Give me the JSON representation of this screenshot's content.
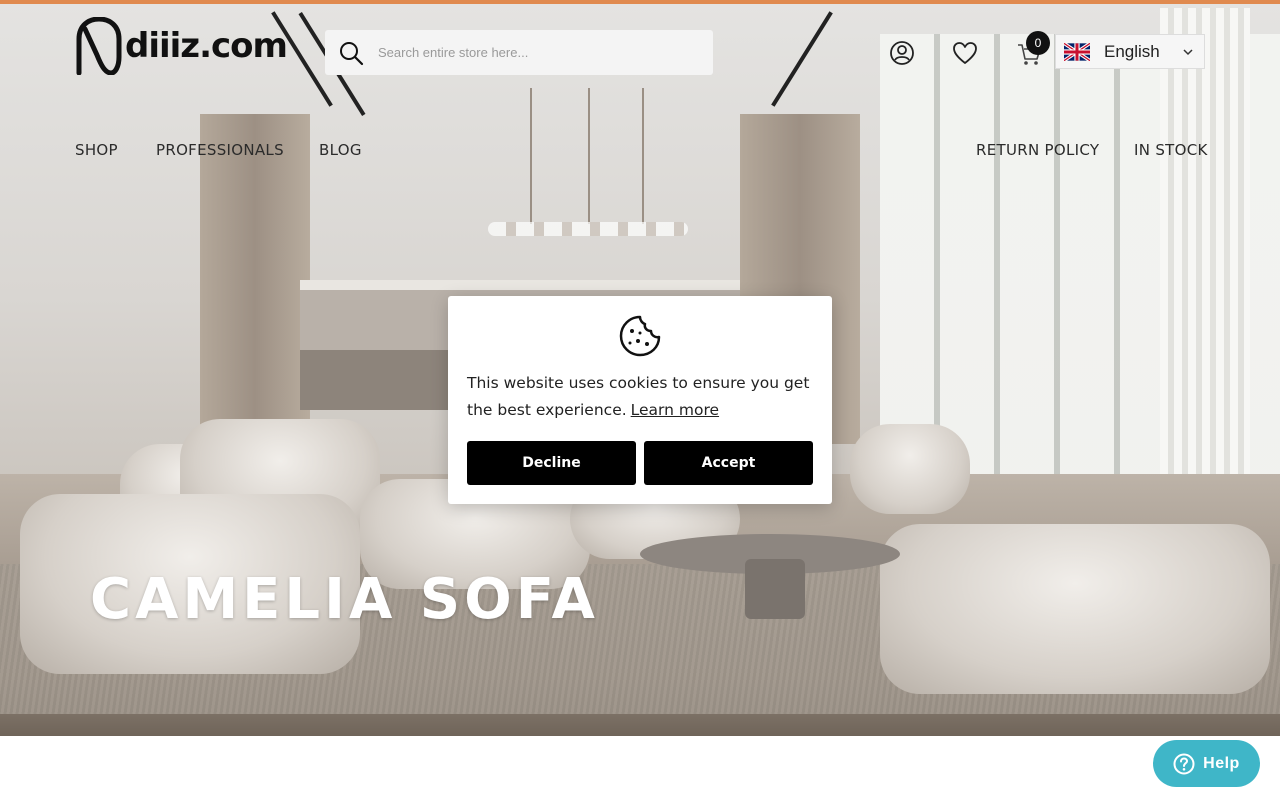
{
  "brand": {
    "name": "diiiz.com"
  },
  "search": {
    "placeholder": "Search entire store here..."
  },
  "header": {
    "cart_count": "0",
    "language": "English"
  },
  "nav": {
    "left": [
      "SHOP",
      "PROFESSIONALS",
      "BLOG"
    ],
    "right": [
      "RETURN POLICY",
      "IN STOCK"
    ]
  },
  "hero": {
    "title": "CAMELIA SOFA"
  },
  "cookie": {
    "message": "This website uses cookies to ensure you get the best experience.",
    "learn_more": "Learn more",
    "decline": "Decline",
    "accept": "Accept"
  },
  "help": {
    "label": "Help"
  },
  "colors": {
    "accent_bar": "#e08a4f",
    "help_bg": "#3fb6c8",
    "button_bg": "#000000"
  },
  "icons": [
    "search-icon",
    "account-icon",
    "wishlist-heart-icon",
    "cart-icon",
    "uk-flag-icon",
    "chevron-down-icon",
    "cookie-icon",
    "help-question-icon"
  ]
}
